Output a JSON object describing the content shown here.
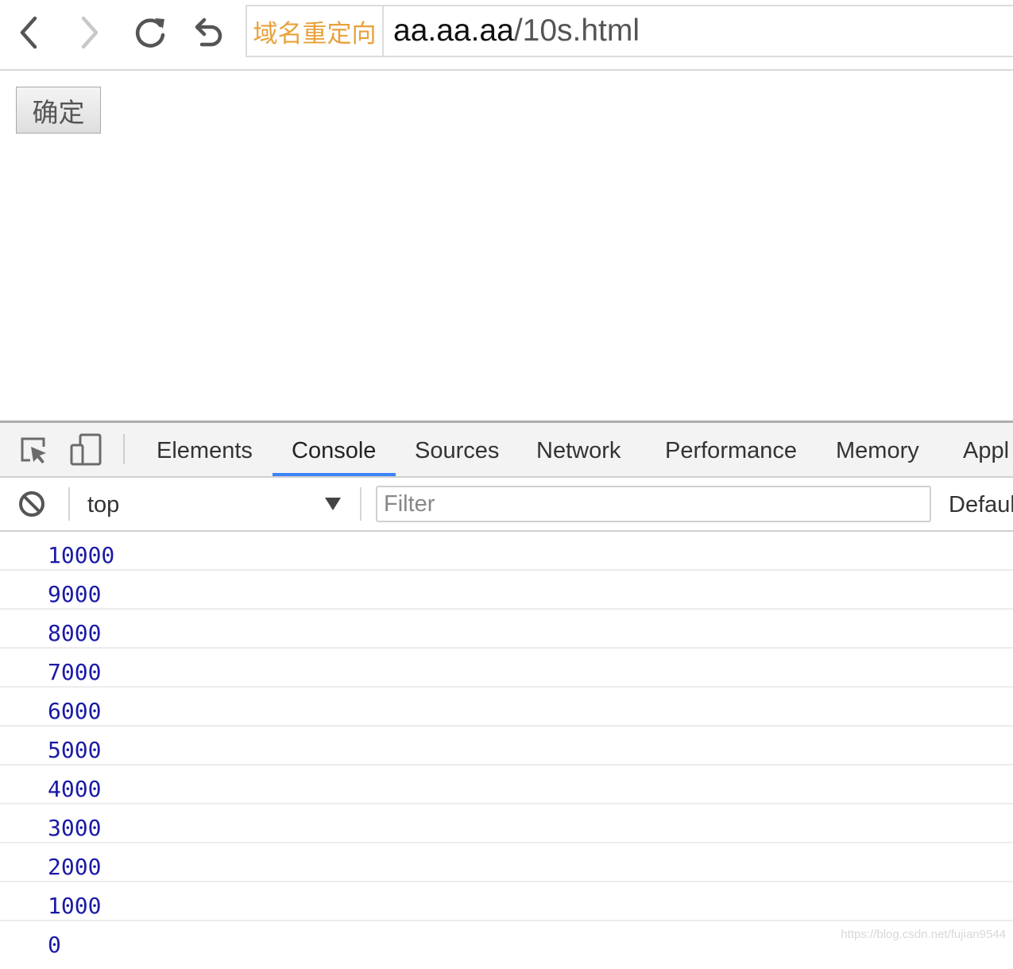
{
  "browser": {
    "badge": "域名重定向",
    "url_host": "aa.aa.aa",
    "url_path": "/10s.html"
  },
  "page": {
    "confirm_label": "确定"
  },
  "devtools": {
    "tabs": [
      "Elements",
      "Console",
      "Sources",
      "Network",
      "Performance",
      "Memory",
      "Appl"
    ],
    "active_tab": "Console",
    "context": "top",
    "filter_placeholder": "Filter",
    "levels_label": "Defaul",
    "logs": [
      "10000",
      "9000",
      "8000",
      "7000",
      "6000",
      "5000",
      "4000",
      "3000",
      "2000",
      "1000",
      "0"
    ]
  },
  "watermark": "https://blog.csdn.net/fujian9544",
  "colors": {
    "badge": "#e8a13a",
    "log_number": "#1a1aa6",
    "tab_active_underline": "#3b82f6"
  },
  "icons": [
    "back-icon",
    "forward-icon",
    "reload-icon",
    "undo-icon",
    "inspect-icon",
    "device-toggle-icon",
    "clear-console-icon",
    "dropdown-arrow-icon"
  ]
}
